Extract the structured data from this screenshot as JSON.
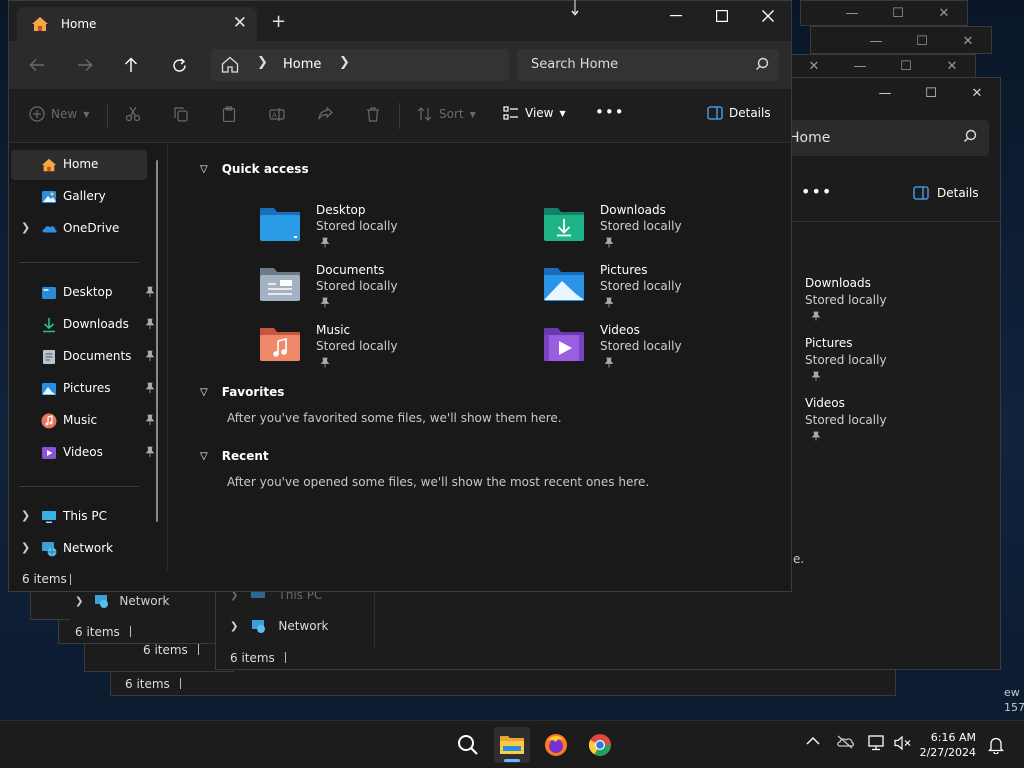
{
  "window": {
    "tab_title": "Home",
    "tab_close": "✕",
    "new_tab": "+",
    "address_location": "Home",
    "search_placeholder": "Search Home",
    "status": "6 items"
  },
  "toolbar": {
    "new_label": "New",
    "sort_label": "Sort",
    "view_label": "View",
    "more_label": "•••",
    "details_label": "Details"
  },
  "sidebar": {
    "top": [
      {
        "label": "Home",
        "icon": "home-icon",
        "active": true
      },
      {
        "label": "Gallery",
        "icon": "gallery-icon"
      },
      {
        "label": "OneDrive",
        "icon": "onedrive-icon",
        "expandable": true
      }
    ],
    "pinned": [
      {
        "label": "Desktop",
        "icon": "desktop-folder-icon"
      },
      {
        "label": "Downloads",
        "icon": "downloads-folder-icon"
      },
      {
        "label": "Documents",
        "icon": "documents-folder-icon"
      },
      {
        "label": "Pictures",
        "icon": "pictures-folder-icon"
      },
      {
        "label": "Music",
        "icon": "music-folder-icon"
      },
      {
        "label": "Videos",
        "icon": "videos-folder-icon"
      }
    ],
    "bottom": [
      {
        "label": "This PC",
        "icon": "this-pc-icon"
      },
      {
        "label": "Network",
        "icon": "network-icon"
      }
    ]
  },
  "quick_access": {
    "title": "Quick access",
    "items": [
      {
        "name": "Desktop",
        "sub": "Stored locally",
        "color": "#2b8bd8"
      },
      {
        "name": "Downloads",
        "sub": "Stored locally",
        "color": "#1fa37e"
      },
      {
        "name": "Documents",
        "sub": "Stored locally",
        "color": "#8d9aa8"
      },
      {
        "name": "Pictures",
        "sub": "Stored locally",
        "color": "#2a8ee0"
      },
      {
        "name": "Music",
        "sub": "Stored locally",
        "color": "#e8765c"
      },
      {
        "name": "Videos",
        "sub": "Stored locally",
        "color": "#8c52d6"
      }
    ]
  },
  "favorites": {
    "title": "Favorites",
    "message": "After you've favorited some files, we'll show them here."
  },
  "recent": {
    "title": "Recent",
    "message": "After you've opened some files, we'll show the most recent ones here."
  },
  "background_windows": {
    "right_search": "Home",
    "right_details": "Details",
    "right_more": "•••",
    "right_items": [
      {
        "name": "Downloads",
        "sub": "Stored locally"
      },
      {
        "name": "Pictures",
        "sub": "Stored locally"
      },
      {
        "name": "Videos",
        "sub": "Stored locally"
      }
    ],
    "right_fragment": "e.",
    "network_label": "Network",
    "this_pc_label": "This PC",
    "status_a": "6 items",
    "status_b": "6 items",
    "status_c": "6 items",
    "status_d": "6 items",
    "network_label_2": "Network",
    "desktop_frag_1": "ew",
    "desktop_frag_2": "157"
  },
  "taskbar": {
    "time": "6:16 AM",
    "date": "2/27/2024"
  }
}
